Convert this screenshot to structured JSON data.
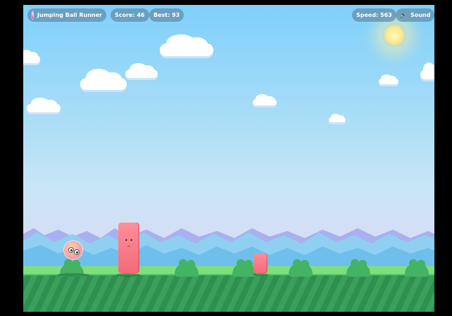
{
  "hud": {
    "title": "Jumping Ball Runner",
    "score_label": "Score: 46",
    "best_label": "Best: 93",
    "speed_label": "Speed: 563",
    "sound_label": "Sound"
  },
  "icons": {
    "logo": "ball-icon",
    "sound": "speaker-icon"
  },
  "colors": {
    "sky_top": "#7fd0fb",
    "ground": "#3aa05b",
    "obstacle": "#f46a78",
    "hud_pill": "#5f8caa"
  }
}
